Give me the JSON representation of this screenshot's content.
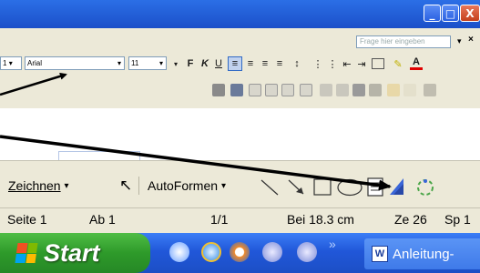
{
  "title_bar": {
    "minimize_icon": "minimize-icon",
    "maximize_icon": "maximize-icon",
    "close_icon": "close-icon",
    "close_glyph": "X"
  },
  "help": {
    "placeholder": "Frage hier eingeben"
  },
  "format_toolbar": {
    "style_value": "1",
    "font_value": "Arial",
    "size_value": "11",
    "bold": "F",
    "italic": "K",
    "underline": "U",
    "font_color_letter": "A"
  },
  "drawing_toolbar": {
    "draw_label": "Zeichnen",
    "autoshapes_label": "AutoFormen",
    "draw_arrow": "▾",
    "autoshapes_arrow": "▾"
  },
  "status_bar": {
    "page": "Seite 1",
    "section": "Ab 1",
    "pages": "1/1",
    "position": "Bei 18.3 cm",
    "line": "Ze 26",
    "column": "Sp 1"
  },
  "taskbar": {
    "start_label": "Start",
    "more_glyph": "»",
    "word_task_label": "Anleitung-"
  },
  "colors": {
    "xp_blue": "#2157d9",
    "start_green": "#2e9a2a",
    "toolbar_bg": "#ece9d8"
  }
}
